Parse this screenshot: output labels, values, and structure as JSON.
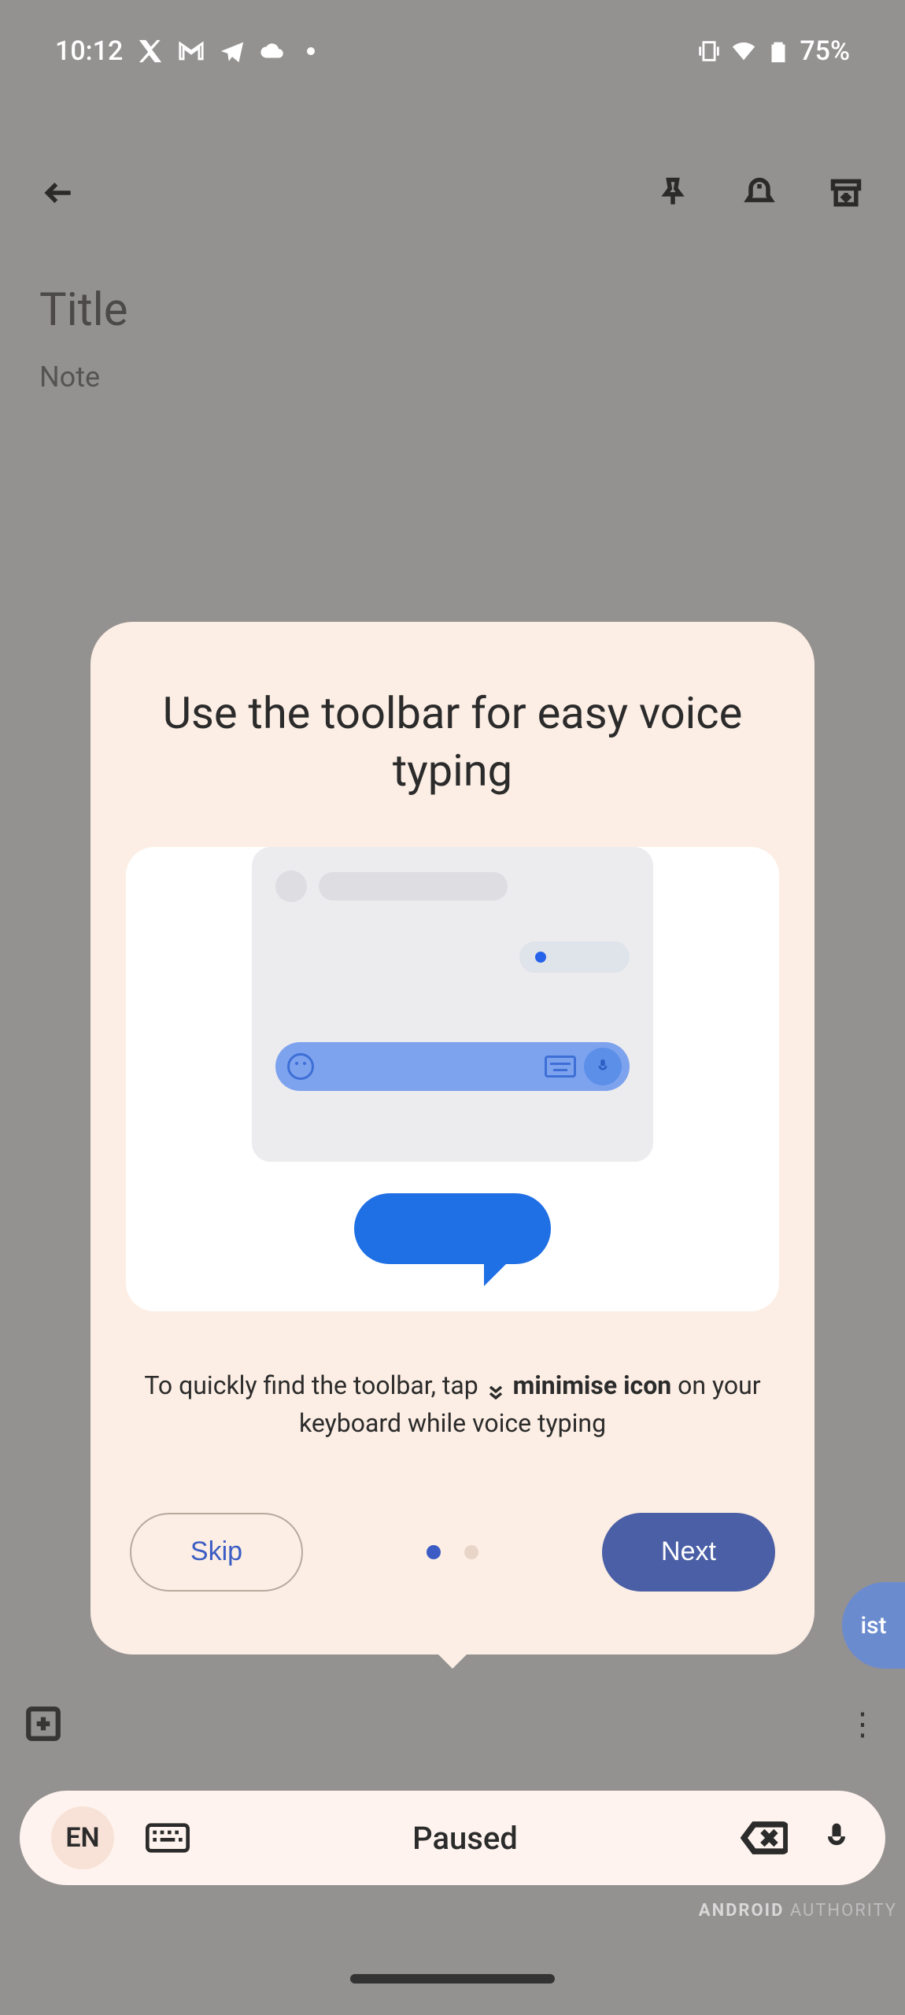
{
  "status_bar": {
    "time": "10:12",
    "battery": "75%"
  },
  "note": {
    "title_placeholder": "Title",
    "body_placeholder": "Note"
  },
  "peek_label": "ist",
  "voice_pill": {
    "language": "EN",
    "status": "Paused"
  },
  "modal": {
    "title": "Use the toolbar for easy voice typing",
    "desc_part1": "To quickly find the toolbar, tap ",
    "desc_bold": "minimise icon",
    "desc_part2": " on your keyboard while ",
    "desc_part3": "voice typing",
    "skip_label": "Skip",
    "next_label": "Next",
    "page_current": 1,
    "page_total": 2
  },
  "watermark": {
    "brand": "ANDROID",
    "site": "AUTHORITY"
  }
}
